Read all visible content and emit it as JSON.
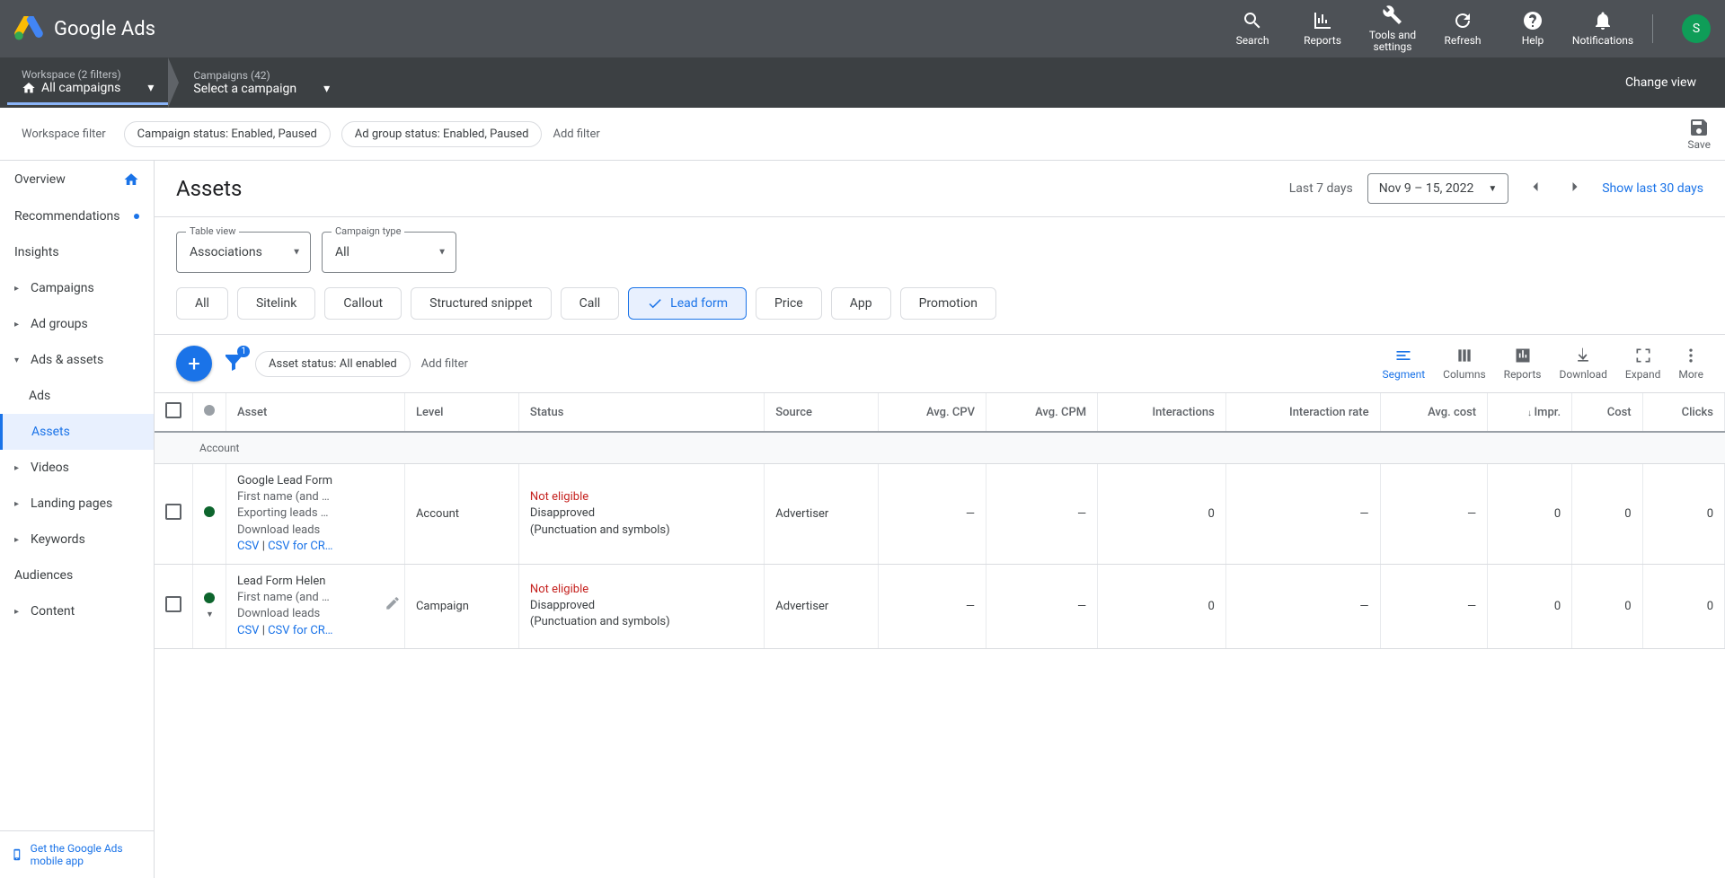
{
  "header": {
    "product_name": "Google Ads",
    "icons": {
      "search": "Search",
      "reports": "Reports",
      "tools": "Tools and settings",
      "refresh": "Refresh",
      "help": "Help",
      "notifications": "Notifications"
    },
    "avatar_initial": "S"
  },
  "breadcrumbs": {
    "workspace_top": "Workspace (2 filters)",
    "workspace_bottom": "All campaigns",
    "campaign_top": "Campaigns (42)",
    "campaign_bottom": "Select a campaign",
    "change_view": "Change view"
  },
  "workspace_filter": {
    "label": "Workspace filter",
    "chip1": "Campaign status: Enabled, Paused",
    "chip2": "Ad group status: Enabled, Paused",
    "add": "Add filter",
    "save": "Save"
  },
  "left_nav": {
    "overview": "Overview",
    "recommendations": "Recommendations",
    "insights": "Insights",
    "campaigns": "Campaigns",
    "ad_groups": "Ad groups",
    "ads_and_assets": "Ads & assets",
    "ads": "Ads",
    "assets": "Assets",
    "videos": "Videos",
    "landing_pages": "Landing pages",
    "keywords": "Keywords",
    "audiences": "Audiences",
    "content": "Content",
    "mobile_app": "Get the Google Ads mobile app"
  },
  "page": {
    "title": "Assets",
    "date_label": "Last 7 days",
    "date_range": "Nov 9 – 15, 2022",
    "show30": "Show last 30 days"
  },
  "selectors": {
    "table_view_label": "Table view",
    "table_view_value": "Associations",
    "campaign_type_label": "Campaign type",
    "campaign_type_value": "All"
  },
  "asset_types": {
    "all": "All",
    "sitelink": "Sitelink",
    "callout": "Callout",
    "structured": "Structured snippet",
    "call": "Call",
    "lead": "Lead form",
    "price": "Price",
    "app": "App",
    "promotion": "Promotion"
  },
  "toolbar": {
    "status_chip": "Asset status: All enabled",
    "add_filter": "Add filter",
    "filter_count": "1",
    "segment": "Segment",
    "columns": "Columns",
    "reports": "Reports",
    "download": "Download",
    "expand": "Expand",
    "more": "More"
  },
  "columns": {
    "asset": "Asset",
    "level": "Level",
    "status": "Status",
    "source": "Source",
    "avg_cpv": "Avg. CPV",
    "avg_cpm": "Avg. CPM",
    "interactions": "Interactions",
    "interaction_rate": "Interaction rate",
    "avg_cost": "Avg. cost",
    "impr": "Impr.",
    "cost": "Cost",
    "clicks": "Clicks"
  },
  "rows": {
    "group_label": "Account",
    "row1": {
      "name": "Google Lead Form",
      "sub1": "First name (and …",
      "sub2": "Exporting leads …",
      "download": "Download leads",
      "csv": "CSV",
      "csv_crm": "CSV for CR…",
      "sep": " | ",
      "level": "Account",
      "status_ne": "Not eligible",
      "status_line1": "Disapproved",
      "status_line2": "(Punctuation and symbols)",
      "source": "Advertiser",
      "avg_cpv": "—",
      "avg_cpm": "—",
      "interactions": "0",
      "interaction_rate": "—",
      "avg_cost": "—",
      "impr": "0",
      "cost": "0",
      "clicks": "0"
    },
    "row2": {
      "name": "Lead Form Helen",
      "sub1": "First name (and …",
      "download": "Download leads",
      "csv": "CSV",
      "csv_crm": "CSV for CR…",
      "sep": " | ",
      "level": "Campaign",
      "status_ne": "Not eligible",
      "status_line1": "Disapproved",
      "status_line2": "(Punctuation and symbols)",
      "source": "Advertiser",
      "avg_cpv": "—",
      "avg_cpm": "—",
      "interactions": "0",
      "interaction_rate": "—",
      "avg_cost": "—",
      "impr": "0",
      "cost": "0",
      "clicks": "0"
    }
  }
}
